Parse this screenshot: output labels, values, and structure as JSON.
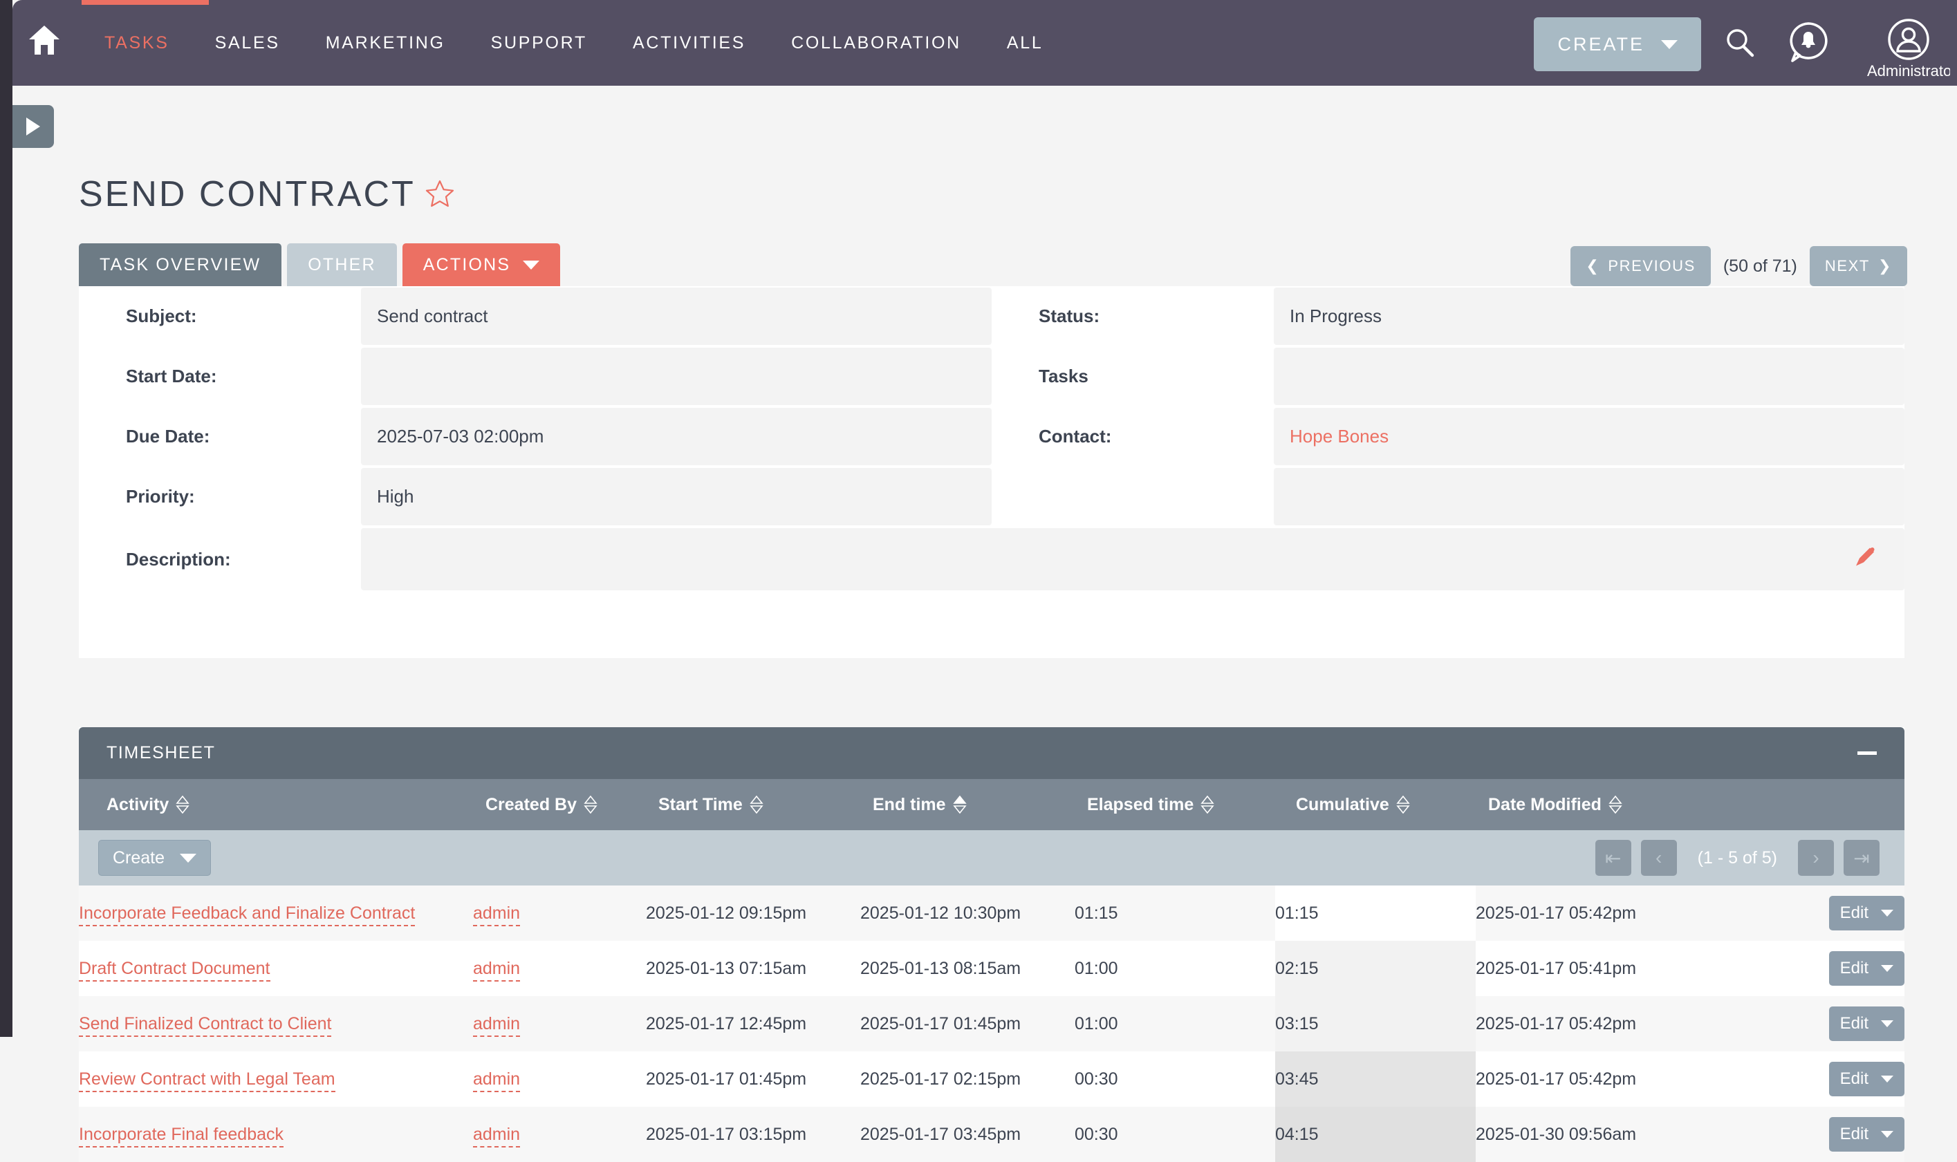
{
  "topnav": {
    "home_icon": "home-icon",
    "items": [
      {
        "label": "TASKS",
        "current": true
      },
      {
        "label": "SALES",
        "current": false
      },
      {
        "label": "MARKETING",
        "current": false
      },
      {
        "label": "SUPPORT",
        "current": false
      },
      {
        "label": "ACTIVITIES",
        "current": false
      },
      {
        "label": "COLLABORATION",
        "current": false
      },
      {
        "label": "ALL",
        "current": false
      }
    ],
    "create_label": "CREATE",
    "search_icon": "search-icon",
    "notifications_icon": "bell-chat-icon",
    "avatar_icon": "user-avatar-icon",
    "avatar_name": "Administrator"
  },
  "page": {
    "title": "SEND CONTRACT",
    "favorite_icon": "star-outline-icon",
    "sidebar_toggle_icon": "triangle-right-icon"
  },
  "tabs": [
    {
      "label": "TASK OVERVIEW",
      "state": "active"
    },
    {
      "label": "OTHER",
      "state": "inactive"
    },
    {
      "label": "ACTIONS",
      "state": "actions"
    }
  ],
  "record_nav": {
    "previous_label": "PREVIOUS",
    "count_label": "(50 of 71)",
    "next_label": "NEXT"
  },
  "form": {
    "left": [
      {
        "label": "Subject:",
        "value": "Send contract",
        "link": false
      },
      {
        "label": "Start Date:",
        "value": "",
        "link": false
      },
      {
        "label": "Due Date:",
        "value": "2025-07-03 02:00pm",
        "link": false
      },
      {
        "label": "Priority:",
        "value": "High",
        "link": false
      }
    ],
    "right": [
      {
        "label": "Status:",
        "value": "In Progress",
        "link": false
      },
      {
        "label": "Tasks",
        "value": "",
        "link": false
      },
      {
        "label": "Contact:",
        "value": "Hope Bones",
        "link": true
      }
    ],
    "description": {
      "label": "Description:",
      "value": "",
      "edit_icon": "pencil-icon"
    }
  },
  "timesheet": {
    "panel_title": "TIMESHEET",
    "collapse_icon": "minus-icon",
    "columns": [
      {
        "label": "Activity",
        "sort": "none"
      },
      {
        "label": "Created By",
        "sort": "none"
      },
      {
        "label": "Start Time",
        "sort": "none"
      },
      {
        "label": "End time",
        "sort": "asc"
      },
      {
        "label": "Elapsed time",
        "sort": "none"
      },
      {
        "label": "Cumulative",
        "sort": "none"
      },
      {
        "label": "Date Modified",
        "sort": "none"
      }
    ],
    "toolbar": {
      "create_label": "Create",
      "pager": {
        "first_icon": "page-first-icon",
        "prev_icon": "page-prev-icon",
        "count_label": "(1 - 5 of 5)",
        "next_icon": "page-next-icon",
        "last_icon": "page-last-icon"
      }
    },
    "rows": [
      {
        "activity": "Incorporate Feedback and Finalize Contract",
        "created_by": "admin",
        "start_time": "2025-01-12 09:15pm",
        "end_time": "2025-01-12 10:30pm",
        "elapsed": "01:15",
        "cumulative": "01:15",
        "date_modified": "2025-01-17 05:42pm",
        "action_label": "Edit"
      },
      {
        "activity": "Draft Contract Document",
        "created_by": "admin",
        "start_time": "2025-01-13 07:15am",
        "end_time": "2025-01-13 08:15am",
        "elapsed": "01:00",
        "cumulative": "02:15",
        "date_modified": "2025-01-17 05:41pm",
        "action_label": "Edit"
      },
      {
        "activity": "Send Finalized Contract to Client",
        "created_by": "admin",
        "start_time": "2025-01-17 12:45pm",
        "end_time": "2025-01-17 01:45pm",
        "elapsed": "01:00",
        "cumulative": "03:15",
        "date_modified": "2025-01-17 05:42pm",
        "action_label": "Edit"
      },
      {
        "activity": "Review Contract with Legal Team",
        "created_by": "admin",
        "start_time": "2025-01-17 01:45pm",
        "end_time": "2025-01-17 02:15pm",
        "elapsed": "00:30",
        "cumulative": "03:45",
        "date_modified": "2025-01-17 05:42pm",
        "action_label": "Edit"
      },
      {
        "activity": "Incorporate Final feedback",
        "created_by": "admin",
        "start_time": "2025-01-17 03:15pm",
        "end_time": "2025-01-17 03:45pm",
        "elapsed": "00:30",
        "cumulative": "04:15",
        "date_modified": "2025-01-30 09:56am",
        "action_label": "Edit"
      }
    ]
  },
  "colors": {
    "nav_bg": "#544f63",
    "accent": "#ec7063",
    "tab_active": "#6d7b85",
    "tab_inactive": "#c2cdd4",
    "panel_head": "#5f6b76",
    "table_head": "#7c8894"
  }
}
